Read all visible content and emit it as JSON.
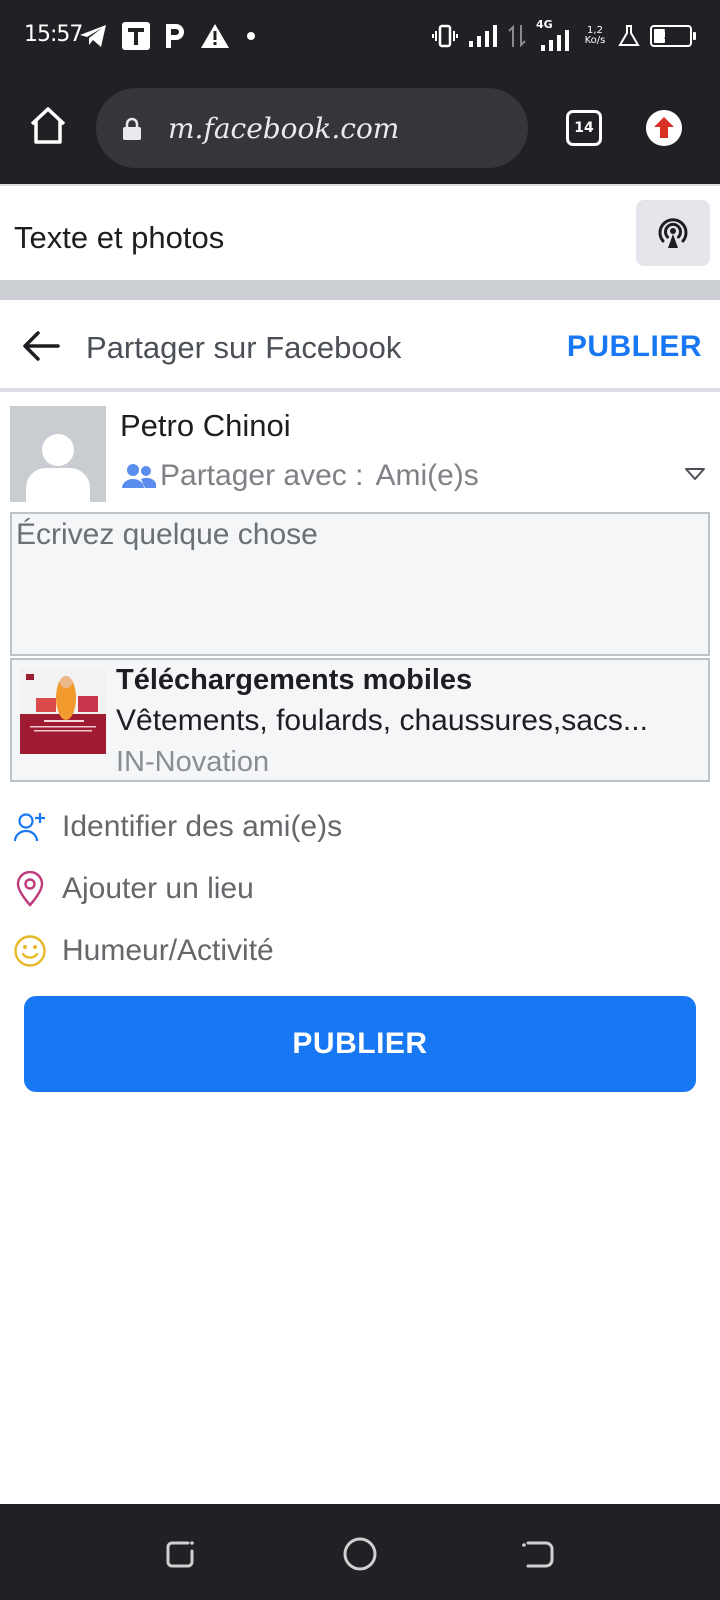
{
  "status_bar": {
    "time": "15:57",
    "network": "4G",
    "speed_top": "1,2",
    "speed_bottom": "Ko/s",
    "battery": "31",
    "battery_fraction": 0.31
  },
  "browser": {
    "url": "m.facebook.com",
    "tab_count": "14"
  },
  "strip": {
    "title": "Texte et photos"
  },
  "share": {
    "title": "Partager sur Facebook",
    "publish_label": "PUBLIER"
  },
  "user": {
    "name": "Petro Chinoi",
    "audience_label": "Partager avec :",
    "audience_value": "Ami(e)s"
  },
  "composer": {
    "placeholder": "Écrivez quelque chose"
  },
  "link_preview": {
    "title": "Téléchargements mobiles",
    "description": "Vêtements, foulards, chaussures,sacs...",
    "source": "IN-Novation"
  },
  "actions": [
    {
      "label": "Identifier des ami(e)s",
      "icon": "tag-friends-icon",
      "color": "#1877f2"
    },
    {
      "label": "Ajouter un lieu",
      "icon": "location-pin-icon",
      "color": "#c0397b"
    },
    {
      "label": "Humeur/Activité",
      "icon": "smiley-icon",
      "color": "#e8b828"
    }
  ],
  "publish_button": {
    "label": "PUBLIER"
  },
  "colors": {
    "accent": "#1877f2",
    "bars": "#202124"
  }
}
